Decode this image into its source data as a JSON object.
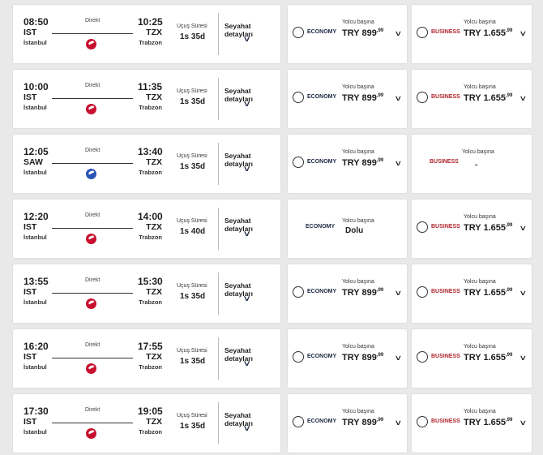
{
  "labels": {
    "direct": "Direkt",
    "duration": "Uçuş Süresi",
    "details": "Seyahat detayları",
    "economy": "ECONOMY",
    "business": "BUSINESS",
    "per_passenger": "Yolcu başına",
    "currency": "TRY"
  },
  "icons": {
    "airline": "airline-logo-icon",
    "expand": "chevron-down-icon",
    "select": "radio-icon"
  },
  "colors": {
    "economy": "#1d2a44",
    "business": "#b0252c",
    "thy": "#c8102e",
    "pegasus": "#2a53b6"
  },
  "flights": [
    {
      "dep_time": "08:50",
      "dep_code": "IST",
      "dep_city": "İstanbul",
      "arr_time": "10:25",
      "arr_code": "TZX",
      "arr_city": "Trabzon",
      "carrier": "thy",
      "duration": "1s 35d",
      "economy": {
        "available": true,
        "price": "899",
        "cents": ",99"
      },
      "business": {
        "available": true,
        "price": "1.655",
        "cents": ",99"
      }
    },
    {
      "dep_time": "10:00",
      "dep_code": "IST",
      "dep_city": "İstanbul",
      "arr_time": "11:35",
      "arr_code": "TZX",
      "arr_city": "Trabzon",
      "carrier": "thy",
      "duration": "1s 35d",
      "economy": {
        "available": true,
        "price": "899",
        "cents": ",99"
      },
      "business": {
        "available": true,
        "price": "1.655",
        "cents": ",99"
      }
    },
    {
      "dep_time": "12:05",
      "dep_code": "SAW",
      "dep_city": "İstanbul",
      "arr_time": "13:40",
      "arr_code": "TZX",
      "arr_city": "Trabzon",
      "carrier": "pgs",
      "duration": "1s 35d",
      "economy": {
        "available": true,
        "price": "899",
        "cents": ",99"
      },
      "business": {
        "available": false,
        "status": "-"
      }
    },
    {
      "dep_time": "12:20",
      "dep_code": "IST",
      "dep_city": "İstanbul",
      "arr_time": "14:00",
      "arr_code": "TZX",
      "arr_city": "Trabzon",
      "carrier": "thy",
      "duration": "1s 40d",
      "economy": {
        "available": false,
        "status": "Dolu"
      },
      "business": {
        "available": true,
        "price": "1.655",
        "cents": ",99"
      }
    },
    {
      "dep_time": "13:55",
      "dep_code": "IST",
      "dep_city": "İstanbul",
      "arr_time": "15:30",
      "arr_code": "TZX",
      "arr_city": "Trabzon",
      "carrier": "thy",
      "duration": "1s 35d",
      "economy": {
        "available": true,
        "price": "899",
        "cents": ",99"
      },
      "business": {
        "available": true,
        "price": "1.655",
        "cents": ",99"
      }
    },
    {
      "dep_time": "16:20",
      "dep_code": "IST",
      "dep_city": "İstanbul",
      "arr_time": "17:55",
      "arr_code": "TZX",
      "arr_city": "Trabzon",
      "carrier": "thy",
      "duration": "1s 35d",
      "economy": {
        "available": true,
        "price": "899",
        "cents": ",99"
      },
      "business": {
        "available": true,
        "price": "1.655",
        "cents": ",99"
      }
    },
    {
      "dep_time": "17:30",
      "dep_code": "IST",
      "dep_city": "İstanbul",
      "arr_time": "19:05",
      "arr_code": "TZX",
      "arr_city": "Trabzon",
      "carrier": "thy",
      "duration": "1s 35d",
      "economy": {
        "available": true,
        "price": "899",
        "cents": ",99"
      },
      "business": {
        "available": true,
        "price": "1.655",
        "cents": ",99"
      }
    }
  ]
}
